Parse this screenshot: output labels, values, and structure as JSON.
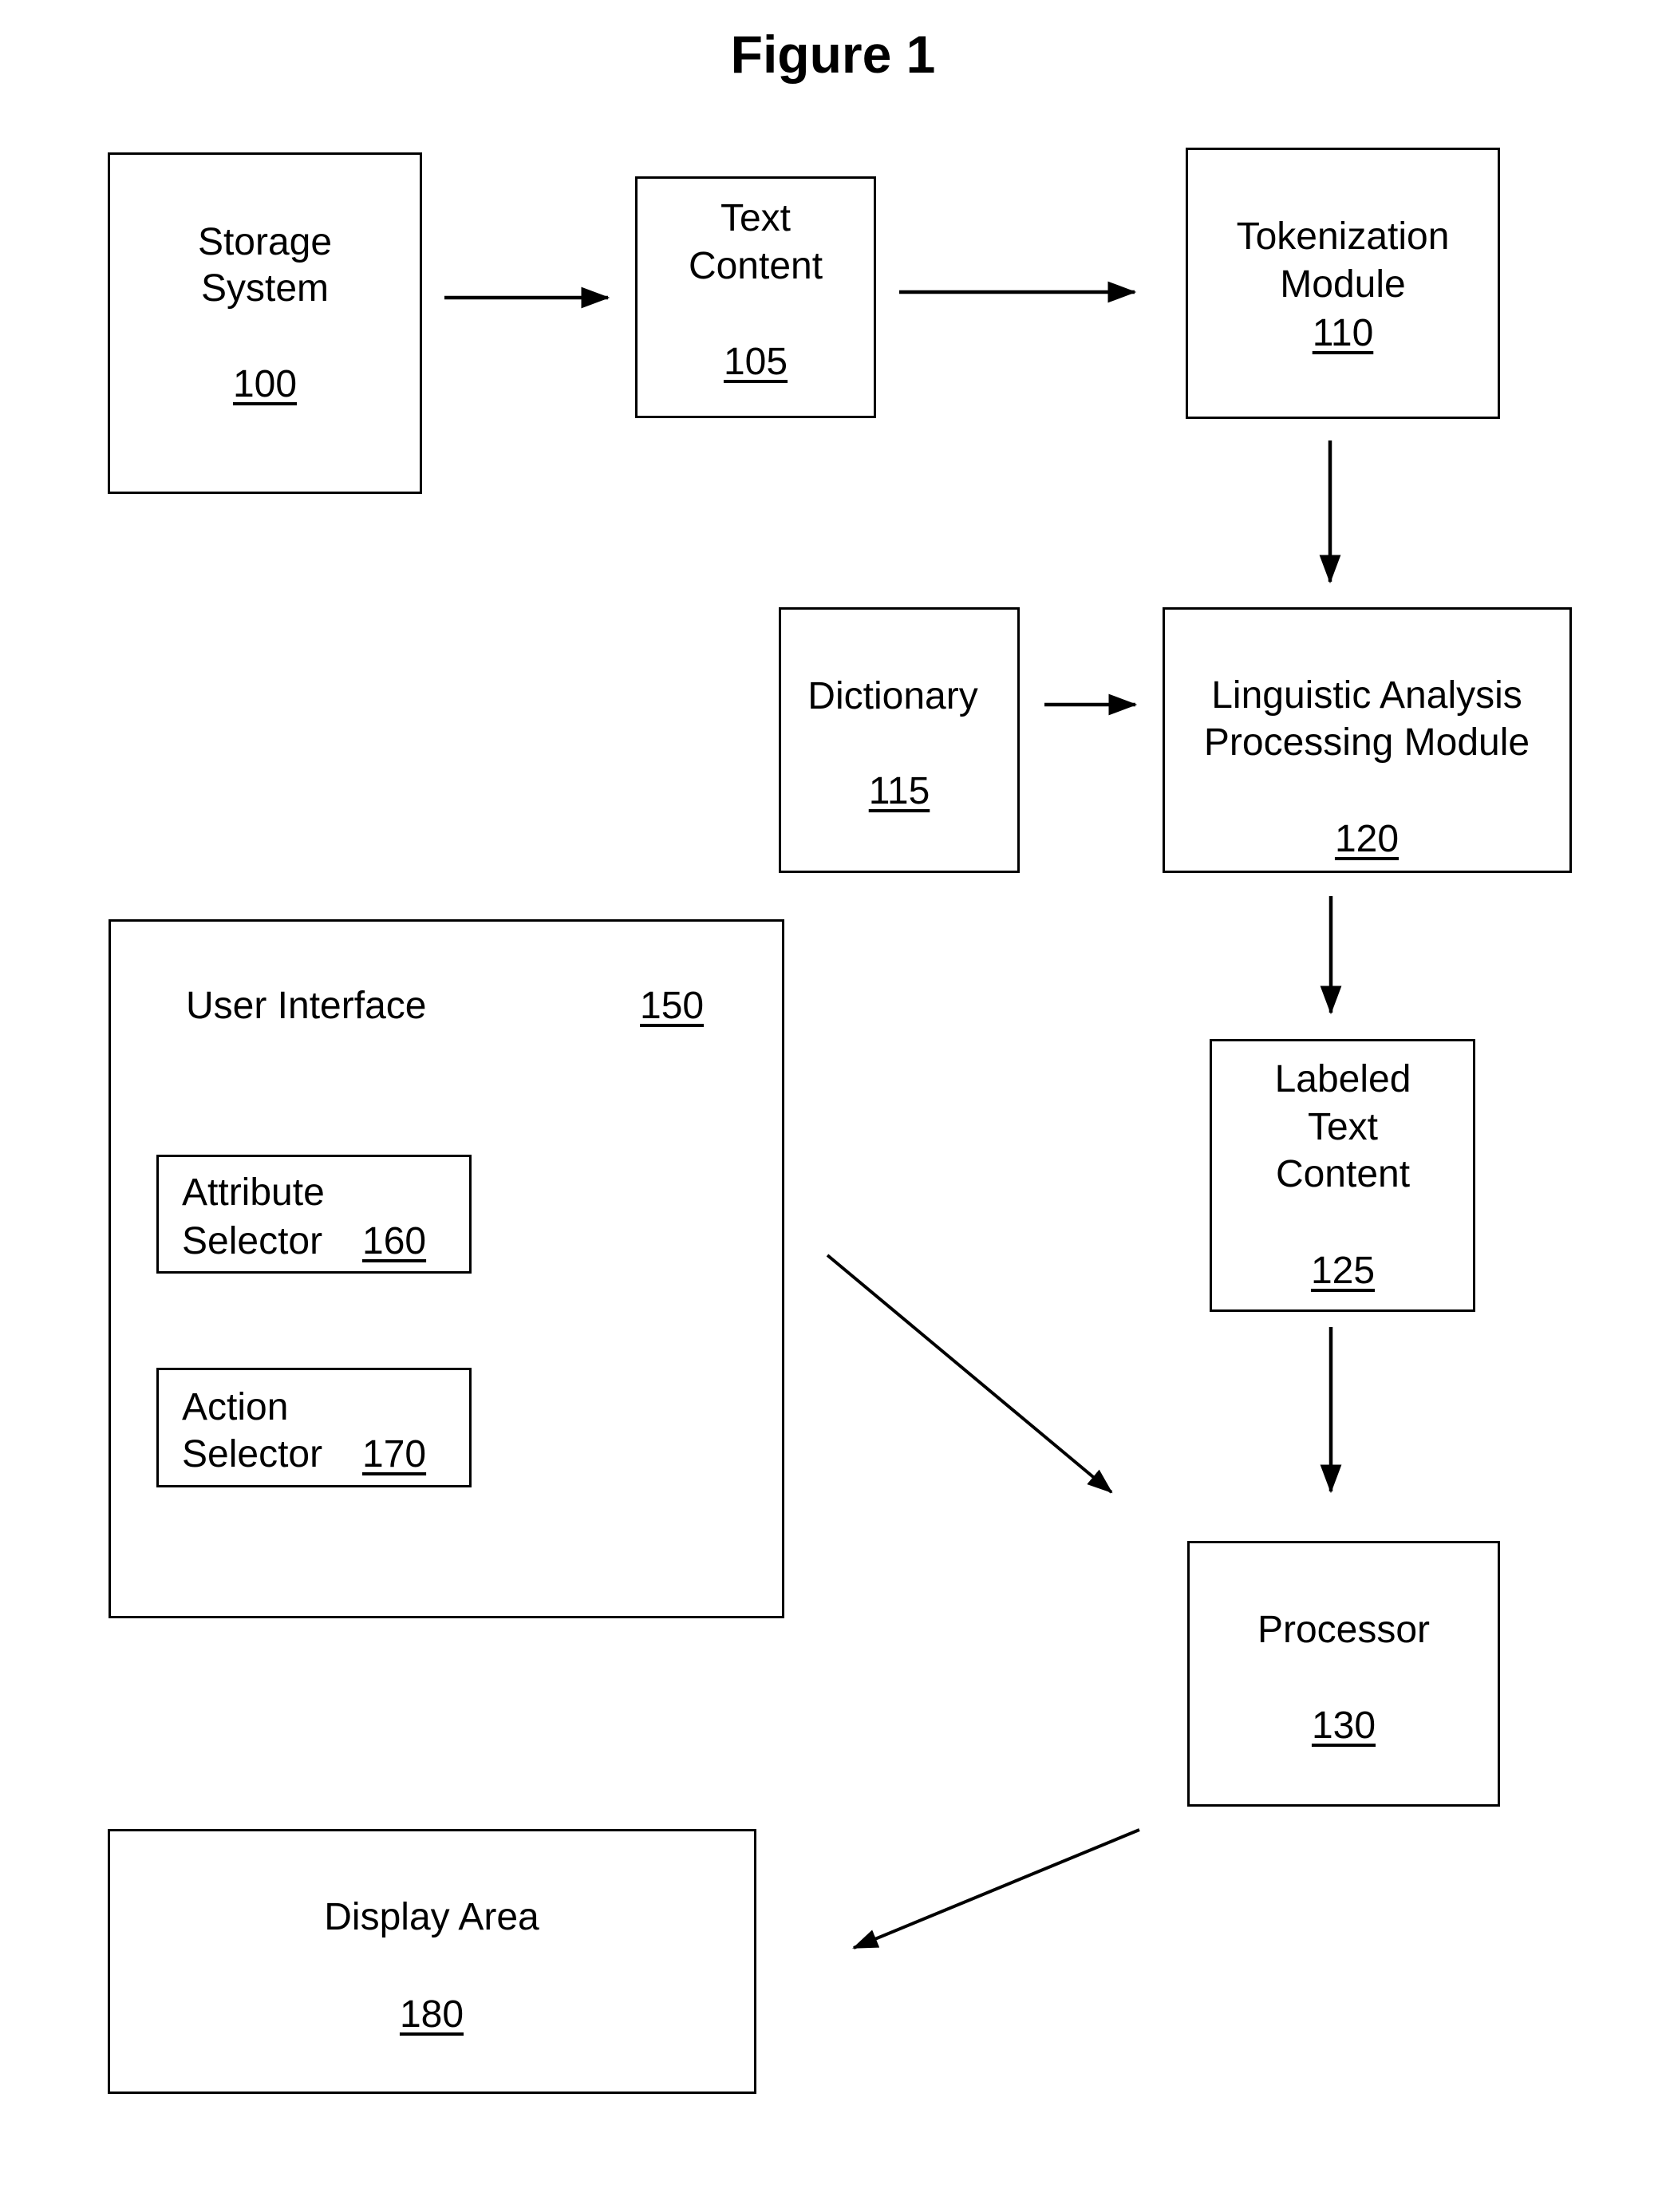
{
  "figure": {
    "title": "Figure 1"
  },
  "nodes": {
    "storage_system": {
      "lines": [
        "Storage",
        "System"
      ],
      "ref": "100"
    },
    "text_content": {
      "lines": [
        "Text",
        "Content"
      ],
      "ref": "105"
    },
    "tokenization_module": {
      "lines": [
        "Tokenization",
        "Module"
      ],
      "ref": "110"
    },
    "dictionary": {
      "lines": [
        "Dictionary"
      ],
      "ref": "115"
    },
    "linguistic_analysis": {
      "lines": [
        "Linguistic Analysis",
        "Processing Module"
      ],
      "ref": "120"
    },
    "labeled_text_content": {
      "lines": [
        "Labeled",
        "Text",
        "Content"
      ],
      "ref": "125"
    },
    "processor": {
      "lines": [
        "Processor"
      ],
      "ref": "130"
    },
    "user_interface": {
      "lines": [
        "User Interface"
      ],
      "ref": "150"
    },
    "attribute_selector": {
      "lines": [
        "Attribute",
        "Selector"
      ],
      "ref": "160"
    },
    "action_selector": {
      "lines": [
        "Action",
        "Selector"
      ],
      "ref": "170"
    },
    "display_area": {
      "lines": [
        "Display Area"
      ],
      "ref": "180"
    }
  },
  "edges": [
    {
      "from": "storage_system",
      "to": "text_content"
    },
    {
      "from": "text_content",
      "to": "tokenization_module"
    },
    {
      "from": "tokenization_module",
      "to": "linguistic_analysis"
    },
    {
      "from": "dictionary",
      "to": "linguistic_analysis"
    },
    {
      "from": "linguistic_analysis",
      "to": "labeled_text_content"
    },
    {
      "from": "labeled_text_content",
      "to": "processor"
    },
    {
      "from": "user_interface",
      "to": "processor"
    },
    {
      "from": "processor",
      "to": "display_area"
    }
  ]
}
